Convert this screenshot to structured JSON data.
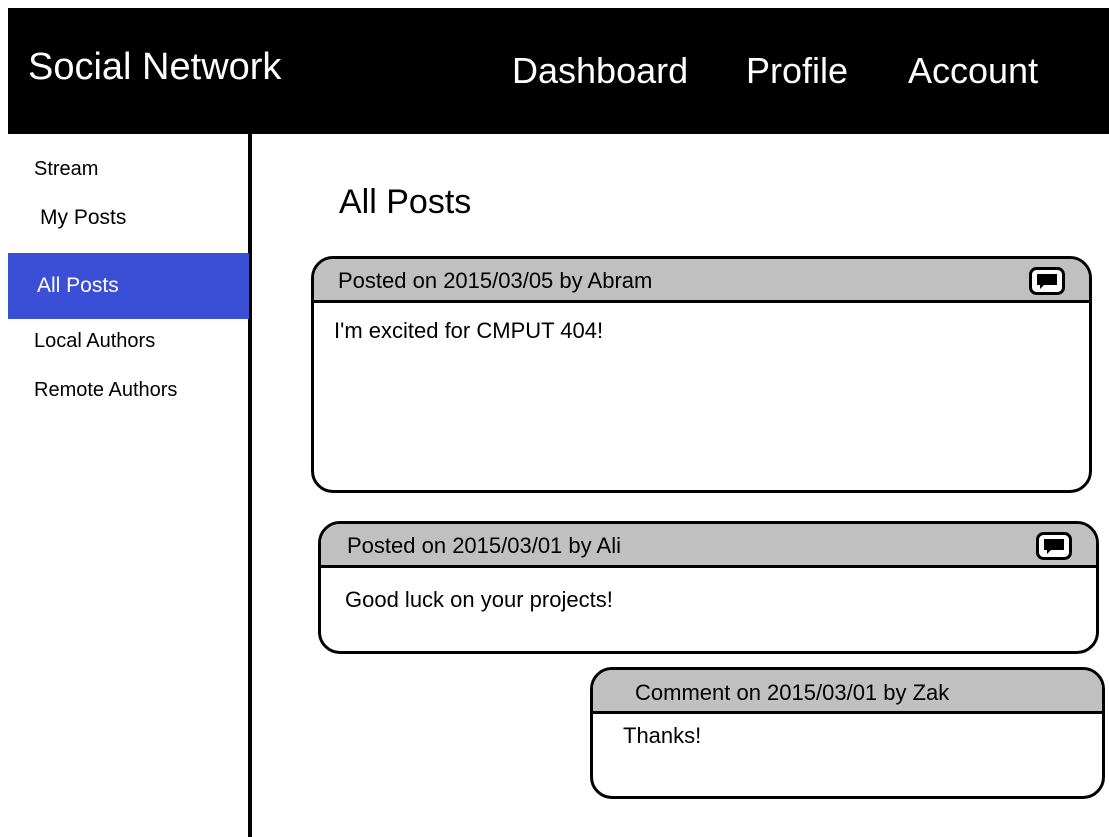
{
  "header": {
    "brand": "Social Network",
    "nav": {
      "dashboard": "Dashboard",
      "profile": "Profile",
      "account": "Account"
    }
  },
  "sidebar": {
    "items": [
      {
        "label": "Stream"
      },
      {
        "label": "My Posts"
      },
      {
        "label": "All Posts",
        "active": true
      },
      {
        "label": "Local Authors"
      },
      {
        "label": "Remote Authors"
      }
    ],
    "active_color": "#3b4fd6"
  },
  "main": {
    "title": "All Posts",
    "posts": [
      {
        "header": "Posted on 2015/03/05  by Abram",
        "body": "I'm excited for CMPUT 404!",
        "icon": "comment-icon"
      },
      {
        "header": "Posted on 2015/03/01  by Ali",
        "body": "Good luck on your projects!",
        "icon": "comment-icon",
        "comments": [
          {
            "header": "Comment on 2015/03/01  by Zak",
            "body": "Thanks!"
          }
        ]
      }
    ]
  },
  "colors": {
    "header_bg": "#000000",
    "card_header_bg": "#c0c0c0"
  }
}
